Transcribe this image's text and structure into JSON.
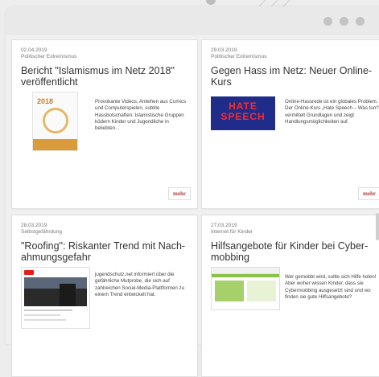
{
  "cards": [
    {
      "date": "02.04.2019",
      "category": "Politischer Extremismus",
      "title": "Bericht \"Islamismus im Netz 2018\" veröffentlicht",
      "description": "Provokante Videos, Anleihen aus Comics und Computerspielen, subtile Hassbotschaften: Islamistische Gruppen ködern Kinder und Jugendliche in beliebten...",
      "more_label": "mehr",
      "thumb_text": "2018"
    },
    {
      "date": "29.03.2019",
      "category": "Politischer Extremismus",
      "title": "Gegen Hass im Netz: Neuer Online-Kurs",
      "description": "Online-Hassrede ist ein globales Problem. Der Online-Kurs „Hate Speech – Was tun?\" vermittelt Grundlagen und zeigt Handlungsmöglichkeiten auf.",
      "more_label": "mehr",
      "thumb_text_1": "HATE",
      "thumb_text_2": "SPEECH"
    },
    {
      "date": "28.03.2019",
      "category": "Selbstgefährdung",
      "title": "\"Roofing\": Riskanter Trend mit Nach-ahmungsgefahr",
      "description": "jugendschutz.net informiert über die gefährliche Mutprobe, die sich auf zahlreichen Social-Media-Plattformen zu einem Trend entwickelt hat."
    },
    {
      "date": "27.03.2019",
      "category": "Internet für Kinder",
      "title": "Hilfsangebote für Kinder bei Cyber-mobbing",
      "description": "Wer gemobbt wird, sollte sich Hilfe holen! Aber woher wissen Kinder, dass sie Cybermobbing ausgesetzt sind und wo finden sie gute Hilfsangebote?"
    }
  ]
}
